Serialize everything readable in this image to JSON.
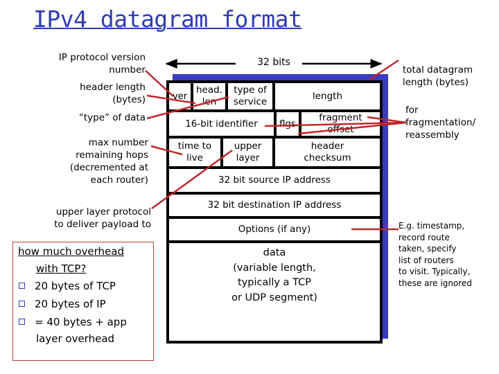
{
  "title": "IPv4 datagram format",
  "width_label": "32 bits",
  "left_labels": {
    "version": [
      "IP protocol version",
      "number"
    ],
    "header_length": [
      "header length",
      "(bytes)"
    ],
    "type_of_data": "“type” of data",
    "ttl": [
      "max number",
      "remaining hops",
      "(decremented at",
      "each router)"
    ],
    "upper_layer": [
      "upper layer protocol",
      "to deliver payload to"
    ]
  },
  "right_labels": {
    "total_length": [
      "total datagram",
      "length (bytes)"
    ],
    "fragmentation": [
      "for",
      "fragmentation/",
      "reassembly"
    ],
    "options_note": [
      "E.g. timestamp,",
      "record route",
      "taken, specify",
      "list of routers",
      "to visit. Typically,",
      "these are ignored"
    ]
  },
  "fields": {
    "ver": "ver",
    "head_len": [
      "head.",
      "len"
    ],
    "type_of_service": [
      "type of",
      "service"
    ],
    "length": "length",
    "identifier": "16-bit identifier",
    "flags": "flgs",
    "fragment_offset": [
      "fragment",
      "offset"
    ],
    "ttl": [
      "time to",
      "live"
    ],
    "upper_layer": [
      "upper",
      "layer"
    ],
    "header_checksum": [
      "header",
      "checksum"
    ],
    "source_ip": "32 bit source IP address",
    "destination_ip": "32 bit destination IP address",
    "options": "Options (if any)",
    "data": [
      "data",
      "(variable length,",
      "typically a TCP",
      "or UDP segment)"
    ]
  },
  "overhead": {
    "heading": [
      "how much overhead",
      "with TCP?"
    ],
    "items": [
      "20 bytes of TCP",
      "20 bytes of IP",
      "= 40 bytes + app",
      "layer overhead"
    ]
  },
  "colors": {
    "title": "#2e3bb0",
    "shadow": "#3b3bc0",
    "pointer_lines": "#c0262a",
    "box_border": "#c0393b"
  }
}
